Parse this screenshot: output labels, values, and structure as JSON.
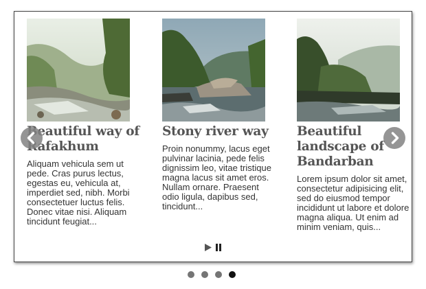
{
  "slides": [
    {
      "title": "Beautiful way of Rafakhum",
      "text": "Aliquam vehicula sem ut pede. Cras purus lectus, egestas eu, vehicula at, imperdiet sed, nibh. Morbi consectetuer luctus felis. Donec vitae nisi. Aliquam tincidunt feugiat...",
      "image": "misty river valley with rocks and trees"
    },
    {
      "title": "Stony river way",
      "text": "Proin nonummy, lacus eget pulvinar lacinia, pede felis dignissim leo, vitae tristique magna lacus sit amet eros. Nullam ornare. Praesent odio ligula, dapibus sed, tincidunt...",
      "image": "river with large boulders and forested hills"
    },
    {
      "title": "Beautiful landscape of Bandarban",
      "text": "Lorem ipsum dolor sit amet, consectetur adipisicing elit, sed do eiusmod tempor incididunt ut labore et dolore magna aliqua. Ut enim ad minim veniam, quis...",
      "image": "hazy river landscape with hills"
    }
  ],
  "controls": {
    "prev_icon": "chevron-left-icon",
    "next_icon": "chevron-right-icon",
    "play_icon": "play-icon",
    "pause_icon": "pause-icon"
  },
  "pagination": {
    "count": 4,
    "active_index": 3
  },
  "colors": {
    "arrow_bg": "#828282",
    "dot": "#757575",
    "dot_active": "#111111",
    "title": "#555555"
  }
}
